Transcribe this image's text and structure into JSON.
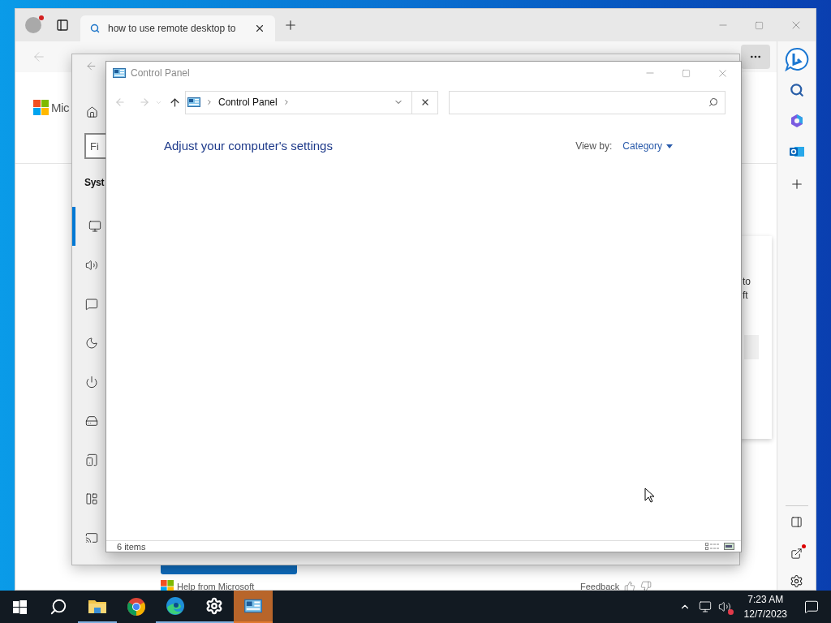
{
  "browser": {
    "tab": {
      "title": "how to use remote desktop to",
      "selected": true
    },
    "page": {
      "logo_text": "Mic",
      "card_lines": [
        "to",
        "ft"
      ],
      "help": "Help from Microsoft",
      "feedback": "Feedback"
    }
  },
  "settings_window": {
    "search": {
      "placeholder": "Fi"
    },
    "section": "Syst",
    "nav": [
      {
        "kind": "display",
        "selected": true
      },
      {
        "kind": "sound",
        "selected": false
      },
      {
        "kind": "notifications",
        "selected": false
      },
      {
        "kind": "focus",
        "selected": false
      },
      {
        "kind": "power",
        "selected": false
      },
      {
        "kind": "storage",
        "selected": false
      },
      {
        "kind": "tablet",
        "selected": false
      },
      {
        "kind": "multitasking",
        "selected": false
      },
      {
        "kind": "projecting",
        "selected": false
      }
    ]
  },
  "control_panel": {
    "title": "Control Panel",
    "breadcrumb": [
      "Control Panel"
    ],
    "heading": "Adjust your computer's settings",
    "view_by_label": "View by:",
    "view_by_value": "Category",
    "status": "6 items"
  },
  "taskbar": {
    "apps": [
      {
        "kind": "start",
        "running": false,
        "selected": false
      },
      {
        "kind": "search",
        "running": false,
        "selected": false
      },
      {
        "kind": "explorer",
        "running": true,
        "selected": false
      },
      {
        "kind": "chrome",
        "running": false,
        "selected": false
      },
      {
        "kind": "edge",
        "running": true,
        "selected": false
      },
      {
        "kind": "settings",
        "running": true,
        "selected": false
      },
      {
        "kind": "control-panel",
        "running": true,
        "selected": true
      }
    ],
    "time": "7:23 AM",
    "date": "12/7/2023"
  }
}
